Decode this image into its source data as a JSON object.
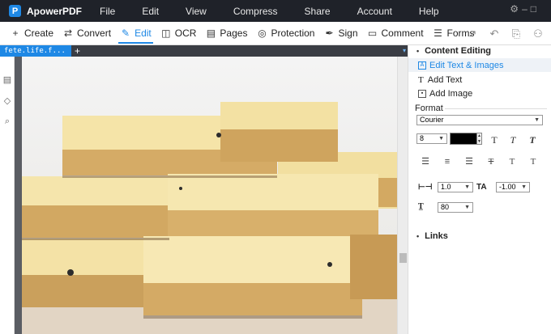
{
  "app": {
    "name": "ApowerPDF",
    "logo_letter": "P"
  },
  "menu": [
    "File",
    "Edit",
    "View",
    "Compress",
    "Share",
    "Account",
    "Help"
  ],
  "toolbar": [
    {
      "label": "Create",
      "icon": "create-icon",
      "glyph": "+"
    },
    {
      "label": "Convert",
      "icon": "convert-icon",
      "glyph": "⇄"
    },
    {
      "label": "Edit",
      "icon": "edit-icon",
      "glyph": "✎",
      "active": true
    },
    {
      "label": "OCR",
      "icon": "ocr-icon",
      "glyph": "◫"
    },
    {
      "label": "Pages",
      "icon": "pages-icon",
      "glyph": "▤"
    },
    {
      "label": "Protection",
      "icon": "shield-icon",
      "glyph": "◎"
    },
    {
      "label": "Sign",
      "icon": "pen-icon",
      "glyph": "✒"
    },
    {
      "label": "Comment",
      "icon": "comment-icon",
      "glyph": "▭"
    },
    {
      "label": "Forms",
      "icon": "forms-icon",
      "glyph": "☰"
    }
  ],
  "toolbar_right": [
    {
      "icon": "share-arrow-icon",
      "glyph": "↗"
    },
    {
      "icon": "undo-icon",
      "glyph": "↶"
    },
    {
      "icon": "attachment-icon",
      "glyph": "⎘"
    },
    {
      "icon": "user-icon",
      "glyph": "⚇"
    }
  ],
  "tabs": {
    "doc_name": "fete.life.f...",
    "new_tab": "+",
    "tab_menu": "▾"
  },
  "panel": {
    "content_editing": "Content Editing",
    "edit_text_images": "Edit Text & Images",
    "add_text": "Add Text",
    "add_image": "Add Image",
    "format": "Format",
    "font": "Courier",
    "font_size": "8",
    "line_spacing": "1.0",
    "char_spacing": "-1.00",
    "scale": "80",
    "links": "Links"
  },
  "colors": {
    "accent": "#1e88e5",
    "titlebar": "#1f2229",
    "text_color": "#000000"
  }
}
